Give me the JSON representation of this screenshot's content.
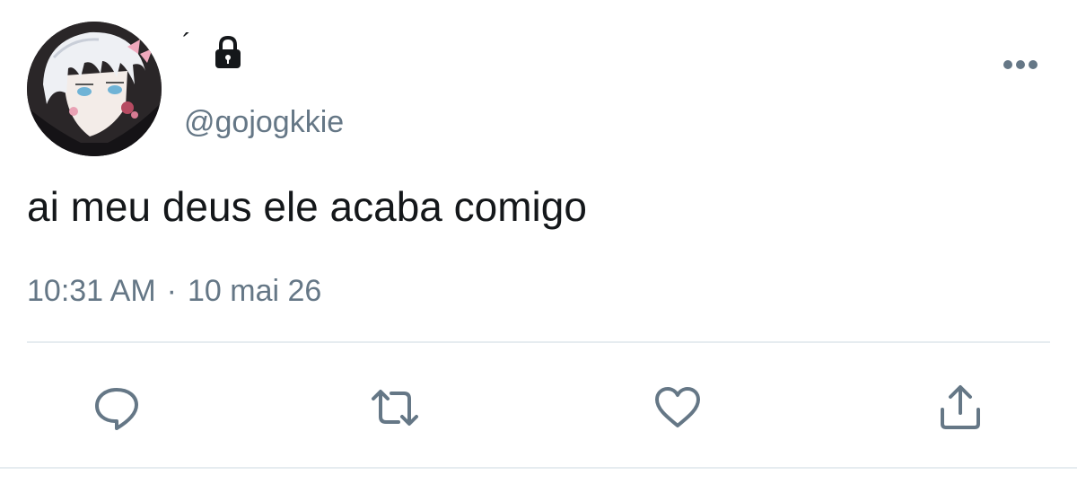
{
  "tweet": {
    "display_name": "´",
    "handle": "@gojogkkie",
    "text": "ai meu deus ele acaba comigo",
    "time": "10:31 AM",
    "separator": "·",
    "date": "10 mai 26",
    "protected": true
  },
  "icons": {
    "avatar": "avatar-image",
    "lock": "lock-icon",
    "more": "more-icon",
    "reply": "reply-icon",
    "retweet": "retweet-icon",
    "like": "like-icon",
    "share": "share-icon"
  },
  "colors": {
    "text": "#14171a",
    "secondary": "#657786",
    "divider": "#e6ecf0",
    "icon": "#657786"
  }
}
